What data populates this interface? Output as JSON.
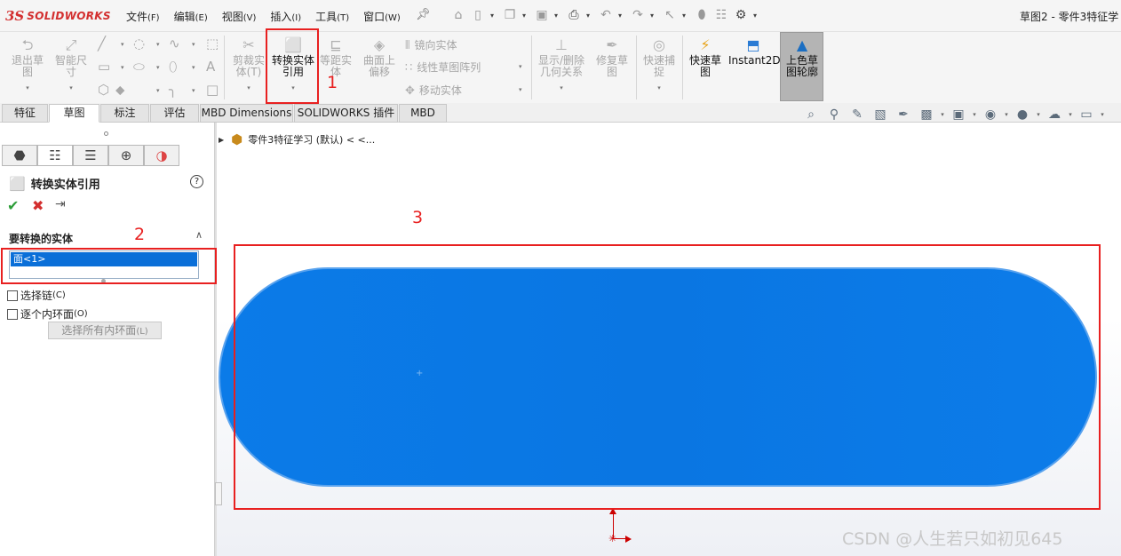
{
  "app": {
    "logo_mark": "3S",
    "logo_text": "SOLIDWORKS",
    "window_title": "草图2 - 零件3特征学"
  },
  "menu": [
    {
      "label": "文件",
      "accel": "(F)"
    },
    {
      "label": "编辑",
      "accel": "(E)"
    },
    {
      "label": "视图",
      "accel": "(V)"
    },
    {
      "label": "插入",
      "accel": "(I)"
    },
    {
      "label": "工具",
      "accel": "(T)"
    },
    {
      "label": "窗口",
      "accel": "(W)"
    }
  ],
  "ribbon": {
    "exit_sketch": "退出草图",
    "smart_dimension": "智能尺寸",
    "trim_entities": "剪裁实体(T)",
    "convert_entities": "转换实体引用",
    "offset_entities": "等距实体",
    "offset_on_surface": "曲面上偏移",
    "mirror_entities": "镜向实体",
    "linear_pattern": "线性草图阵列",
    "move_entities": "移动实体",
    "display_delete_relations": "显示/删除几何关系",
    "repair_sketch": "修复草图",
    "quick_snaps": "快速捕捉",
    "rapid_sketch": "快速草图",
    "instant2d": "Instant2D",
    "shaded_sketch_contours": "上色草图轮廓"
  },
  "tabs": [
    "特征",
    "草图",
    "标注",
    "评估",
    "MBD Dimensions",
    "SOLIDWORKS 插件",
    "MBD"
  ],
  "selected_tab": "草图",
  "property_manager": {
    "title": "转换实体引用",
    "section_title": "要转换的实体",
    "selection_items": [
      "面<1>"
    ],
    "select_chain": {
      "label": "选择链",
      "accel": "(C)",
      "checked": false
    },
    "inner_loops": {
      "label": "逐个内环面",
      "accel": "(O)",
      "checked": false
    },
    "select_all_inner_loops": {
      "label": "选择所有内环面",
      "accel": "(L)"
    }
  },
  "feature_tree": {
    "root_label": "零件3特征学习 (默认) < <..."
  },
  "annotations": [
    "1",
    "2",
    "3"
  ],
  "watermark": "CSDN @人生若只如初见645",
  "colors": {
    "face_fill": "#0a76e2",
    "annotation_red": "#e82020",
    "brand_red": "#d32f2f",
    "selection_blue": "#0a6fd8"
  },
  "icons": {
    "home": "home-icon",
    "new": "new-document-icon",
    "open": "open-folder-icon",
    "save": "save-icon",
    "print": "print-icon",
    "undo": "undo-icon",
    "redo": "redo-icon",
    "select": "select-pointer-icon",
    "rebuild": "rebuild-icon",
    "options": "gear-icon"
  }
}
